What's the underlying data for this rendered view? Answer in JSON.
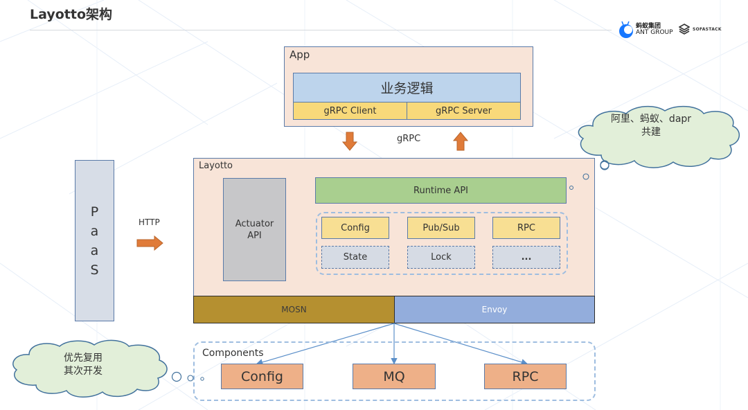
{
  "slide": {
    "title": "Layotto架构"
  },
  "logos": {
    "ant_group_cn": "蚂蚁集团",
    "ant_group_en": "ANT GROUP",
    "sofastack": "SOFASTACK",
    "ant_icon": "ant-logo-icon",
    "sofa_icon": "sofastack-logo-icon"
  },
  "colors": {
    "app_bg": "#f8e4d8",
    "border": "#5a7aa8",
    "biz_bg": "#bdd4ec",
    "grpc_bg": "#f8d97a",
    "runtime_bg": "#a9cf8f",
    "actuator_bg": "#c7c7c9",
    "mosn_bg": "#b59030",
    "envoy_bg": "#93addc",
    "component_bg": "#eeb088",
    "cloud_bg": "#e2efd9",
    "arrow_orange": "#e07b39"
  },
  "app": {
    "label": "App",
    "business_logic": "业务逻辑",
    "grpc_client": "gRPC Client",
    "grpc_server": "gRPC Server"
  },
  "grpc_link": {
    "label": "gRPC"
  },
  "paas": {
    "letters": [
      "P",
      "a",
      "a",
      "S"
    ]
  },
  "http_link": {
    "label": "HTTP"
  },
  "layotto": {
    "label": "Layotto",
    "actuator_line1": "Actuator",
    "actuator_line2": "API",
    "runtime_api": "Runtime API",
    "apis": [
      {
        "label": "Config",
        "style": "solid"
      },
      {
        "label": "Pub/Sub",
        "style": "solid"
      },
      {
        "label": "RPC",
        "style": "solid"
      },
      {
        "label": "State",
        "style": "dashed"
      },
      {
        "label": "Lock",
        "style": "dashed"
      },
      {
        "label": "...",
        "style": "dashed"
      }
    ]
  },
  "sidecars": {
    "mosn": "MOSN",
    "envoy": "Envoy"
  },
  "components": {
    "label": "Components",
    "items": [
      "Config",
      "MQ",
      "RPC"
    ]
  },
  "callouts": {
    "top_right_line1": "阿里、蚂蚁、dapr",
    "top_right_line2": "共建",
    "bottom_left_line1": "优先复用",
    "bottom_left_line2": "其次开发"
  }
}
